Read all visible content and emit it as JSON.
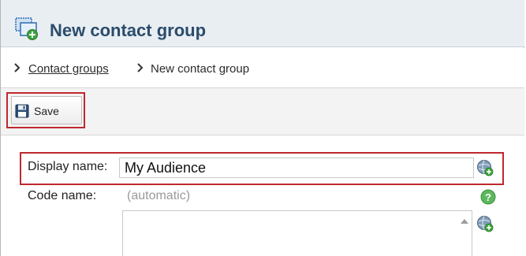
{
  "header": {
    "title": "New contact group",
    "icon": "new-group-icon"
  },
  "breadcrumb": {
    "parent": "Contact groups",
    "current": "New contact group",
    "separator_icon": "chevron-right-icon"
  },
  "toolbar": {
    "save_label": "Save",
    "save_icon": "floppy-disk-icon"
  },
  "form": {
    "display_name_label": "Display name:",
    "display_name_value": "My Audience",
    "code_name_label": "Code name:",
    "code_name_value": "(automatic)",
    "description_value": ""
  },
  "colors": {
    "header_bg": "#e9eef3",
    "title": "#2b4c6b",
    "highlight": "#c0282e",
    "toolbar_bg": "#f3f3f3"
  }
}
